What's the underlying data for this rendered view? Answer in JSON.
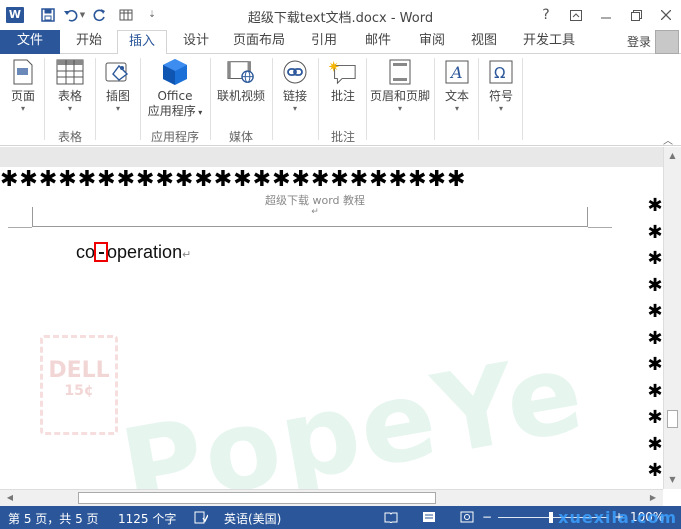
{
  "title_bar": {
    "app_icon": "W",
    "title": "超级下载text文档.docx - Word",
    "help": "?",
    "quick_access": [
      "save-icon",
      "undo-icon",
      "redo-icon",
      "table-icon",
      "customize-icon"
    ]
  },
  "tabs": {
    "file": "文件",
    "items": [
      "开始",
      "插入",
      "设计",
      "页面布局",
      "引用",
      "邮件",
      "审阅",
      "视图",
      "开发工具"
    ],
    "active": "插入",
    "login": "登录"
  },
  "ribbon": {
    "buttons": {
      "pages": "页面",
      "tables": "表格",
      "illustrations": "插图",
      "office_apps_1": "Office",
      "office_apps_2": "应用程序",
      "online_video": "联机视频",
      "links": "链接",
      "comment": "批注",
      "header_footer": "页眉和页脚",
      "text": "文本",
      "symbols": "符号"
    },
    "groups": {
      "tables": "表格",
      "apps": "应用程序",
      "media": "媒体",
      "comments": "批注"
    }
  },
  "document": {
    "header_text": "超级下载 word 教程",
    "header_return": "↵",
    "body_before": "co",
    "body_after": "operation",
    "para_mark": "↵",
    "border_char": "✱",
    "watermark_big": "PopeYe",
    "watermark_stamp_1": "DELL",
    "watermark_stamp_2": "15¢"
  },
  "status_bar": {
    "page": "第 5 页，共 5 页",
    "words": "1125 个字",
    "language": "英语(美国)",
    "zoom": "100%",
    "site_watermark": "xuexila.com"
  },
  "colors": {
    "accent": "#2b579a",
    "highlight_box": "#ee0000"
  }
}
